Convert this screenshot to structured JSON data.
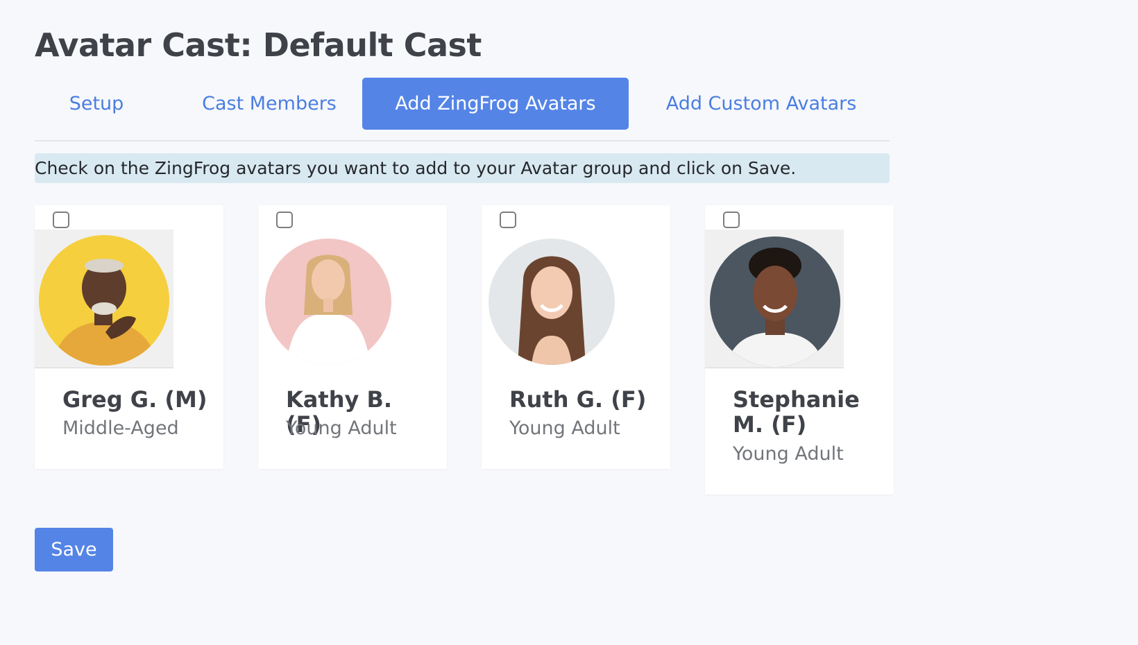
{
  "page": {
    "title": "Avatar Cast: Default Cast"
  },
  "tabs": [
    {
      "label": "Setup",
      "active": false
    },
    {
      "label": "Cast Members",
      "active": false
    },
    {
      "label": "Add ZingFrog Avatars",
      "active": true
    },
    {
      "label": "Add Custom Avatars",
      "active": false
    }
  ],
  "info": {
    "message": "Check on the ZingFrog avatars you want to add to your Avatar group and click on Save."
  },
  "avatars": [
    {
      "name": "Greg G. (M)",
      "age_group": "Middle-Aged",
      "checked": false,
      "bg_color": "#f5cf3d"
    },
    {
      "name": "Kathy B. (F)",
      "age_group": "Young Adult",
      "checked": false,
      "bg_color": "#f2c6c4"
    },
    {
      "name": "Ruth G. (F)",
      "age_group": "Young Adult",
      "checked": false,
      "bg_color": "#e3e7ea"
    },
    {
      "name": "Stephanie M. (F)",
      "age_group": "Young Adult",
      "checked": false,
      "bg_color": "#4b5661"
    }
  ],
  "actions": {
    "save_label": "Save"
  }
}
